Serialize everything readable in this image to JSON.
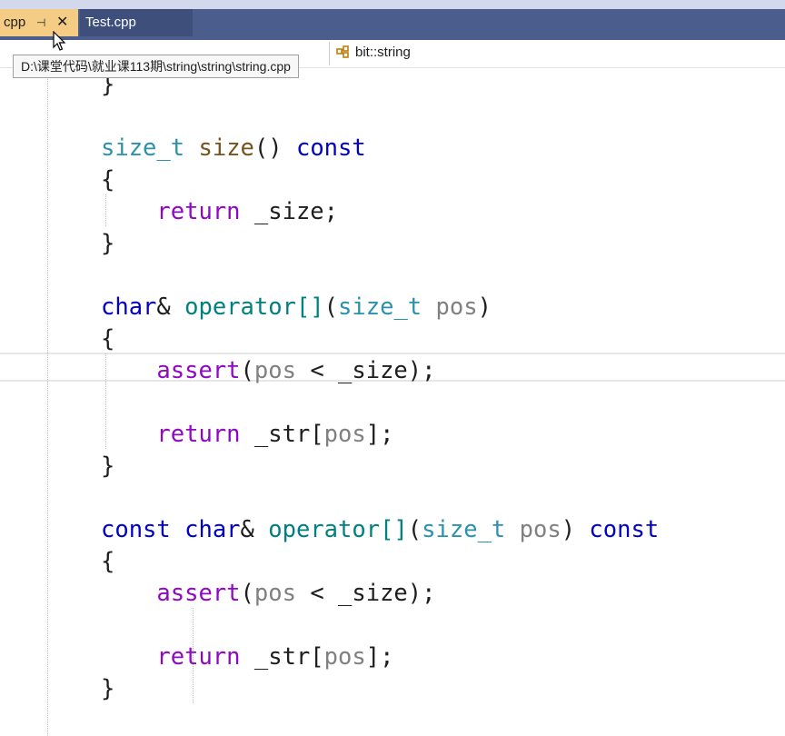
{
  "tabs": [
    {
      "label": "cpp",
      "active": true
    },
    {
      "label": "Test.cpp",
      "active": false
    }
  ],
  "icons": {
    "pin": "pin-icon",
    "close": "close-icon",
    "class": "class-icon",
    "cursor": "mouse-cursor-icon"
  },
  "tooltip": "D:\\课堂代码\\就业课113期\\string\\string\\string.cpp",
  "navigation": {
    "scope": "bit::string"
  },
  "colors": {
    "tab_bar": "#4b5d8d",
    "active_tab": "#f5cc84",
    "keyword": "#0000c8",
    "type": "#2b91af",
    "function": "#74531f",
    "operator_name": "#008080",
    "parameter": "#808080",
    "control": "#8f08c4"
  },
  "code": {
    "lines": [
      [
        {
          "t": "}",
          "c": "plain"
        }
      ],
      [],
      [
        {
          "t": "size_t",
          "c": "ty"
        },
        {
          "t": " ",
          "c": "plain"
        },
        {
          "t": "size",
          "c": "fn"
        },
        {
          "t": "() ",
          "c": "plain"
        },
        {
          "t": "const",
          "c": "kw"
        }
      ],
      [
        {
          "t": "{",
          "c": "plain"
        }
      ],
      [
        {
          "t": "    ",
          "c": "plain"
        },
        {
          "t": "return",
          "c": "ctl"
        },
        {
          "t": " _size;",
          "c": "plain"
        }
      ],
      [
        {
          "t": "}",
          "c": "plain"
        }
      ],
      [],
      [
        {
          "t": "char",
          "c": "kw"
        },
        {
          "t": "& ",
          "c": "plain"
        },
        {
          "t": "operator[]",
          "c": "op"
        },
        {
          "t": "(",
          "c": "plain"
        },
        {
          "t": "size_t",
          "c": "ty"
        },
        {
          "t": " ",
          "c": "plain"
        },
        {
          "t": "pos",
          "c": "pr"
        },
        {
          "t": ")",
          "c": "plain"
        }
      ],
      [
        {
          "t": "{",
          "c": "plain"
        }
      ],
      [
        {
          "t": "    ",
          "c": "plain"
        },
        {
          "t": "assert",
          "c": "ctl"
        },
        {
          "t": "(",
          "c": "plain"
        },
        {
          "t": "pos",
          "c": "pr"
        },
        {
          "t": " < _size);",
          "c": "plain"
        }
      ],
      [],
      [
        {
          "t": "    ",
          "c": "plain"
        },
        {
          "t": "return",
          "c": "ctl"
        },
        {
          "t": " _str[",
          "c": "plain"
        },
        {
          "t": "pos",
          "c": "pr"
        },
        {
          "t": "];",
          "c": "plain"
        }
      ],
      [
        {
          "t": "}",
          "c": "plain"
        }
      ],
      [],
      [
        {
          "t": "const",
          "c": "kw"
        },
        {
          "t": " ",
          "c": "plain"
        },
        {
          "t": "char",
          "c": "kw"
        },
        {
          "t": "& ",
          "c": "plain"
        },
        {
          "t": "operator[]",
          "c": "op"
        },
        {
          "t": "(",
          "c": "plain"
        },
        {
          "t": "size_t",
          "c": "ty"
        },
        {
          "t": " ",
          "c": "plain"
        },
        {
          "t": "pos",
          "c": "pr"
        },
        {
          "t": ") ",
          "c": "plain"
        },
        {
          "t": "const",
          "c": "kw"
        }
      ],
      [
        {
          "t": "{",
          "c": "plain"
        }
      ],
      [
        {
          "t": "    ",
          "c": "plain"
        },
        {
          "t": "assert",
          "c": "ctl"
        },
        {
          "t": "(",
          "c": "plain"
        },
        {
          "t": "pos",
          "c": "pr"
        },
        {
          "t": " < _size);",
          "c": "plain"
        }
      ],
      [],
      [
        {
          "t": "    ",
          "c": "plain"
        },
        {
          "t": "return",
          "c": "ctl"
        },
        {
          "t": " _str[",
          "c": "plain"
        },
        {
          "t": "pos",
          "c": "pr"
        },
        {
          "t": "];",
          "c": "plain"
        }
      ],
      [
        {
          "t": "}",
          "c": "plain"
        }
      ]
    ]
  }
}
